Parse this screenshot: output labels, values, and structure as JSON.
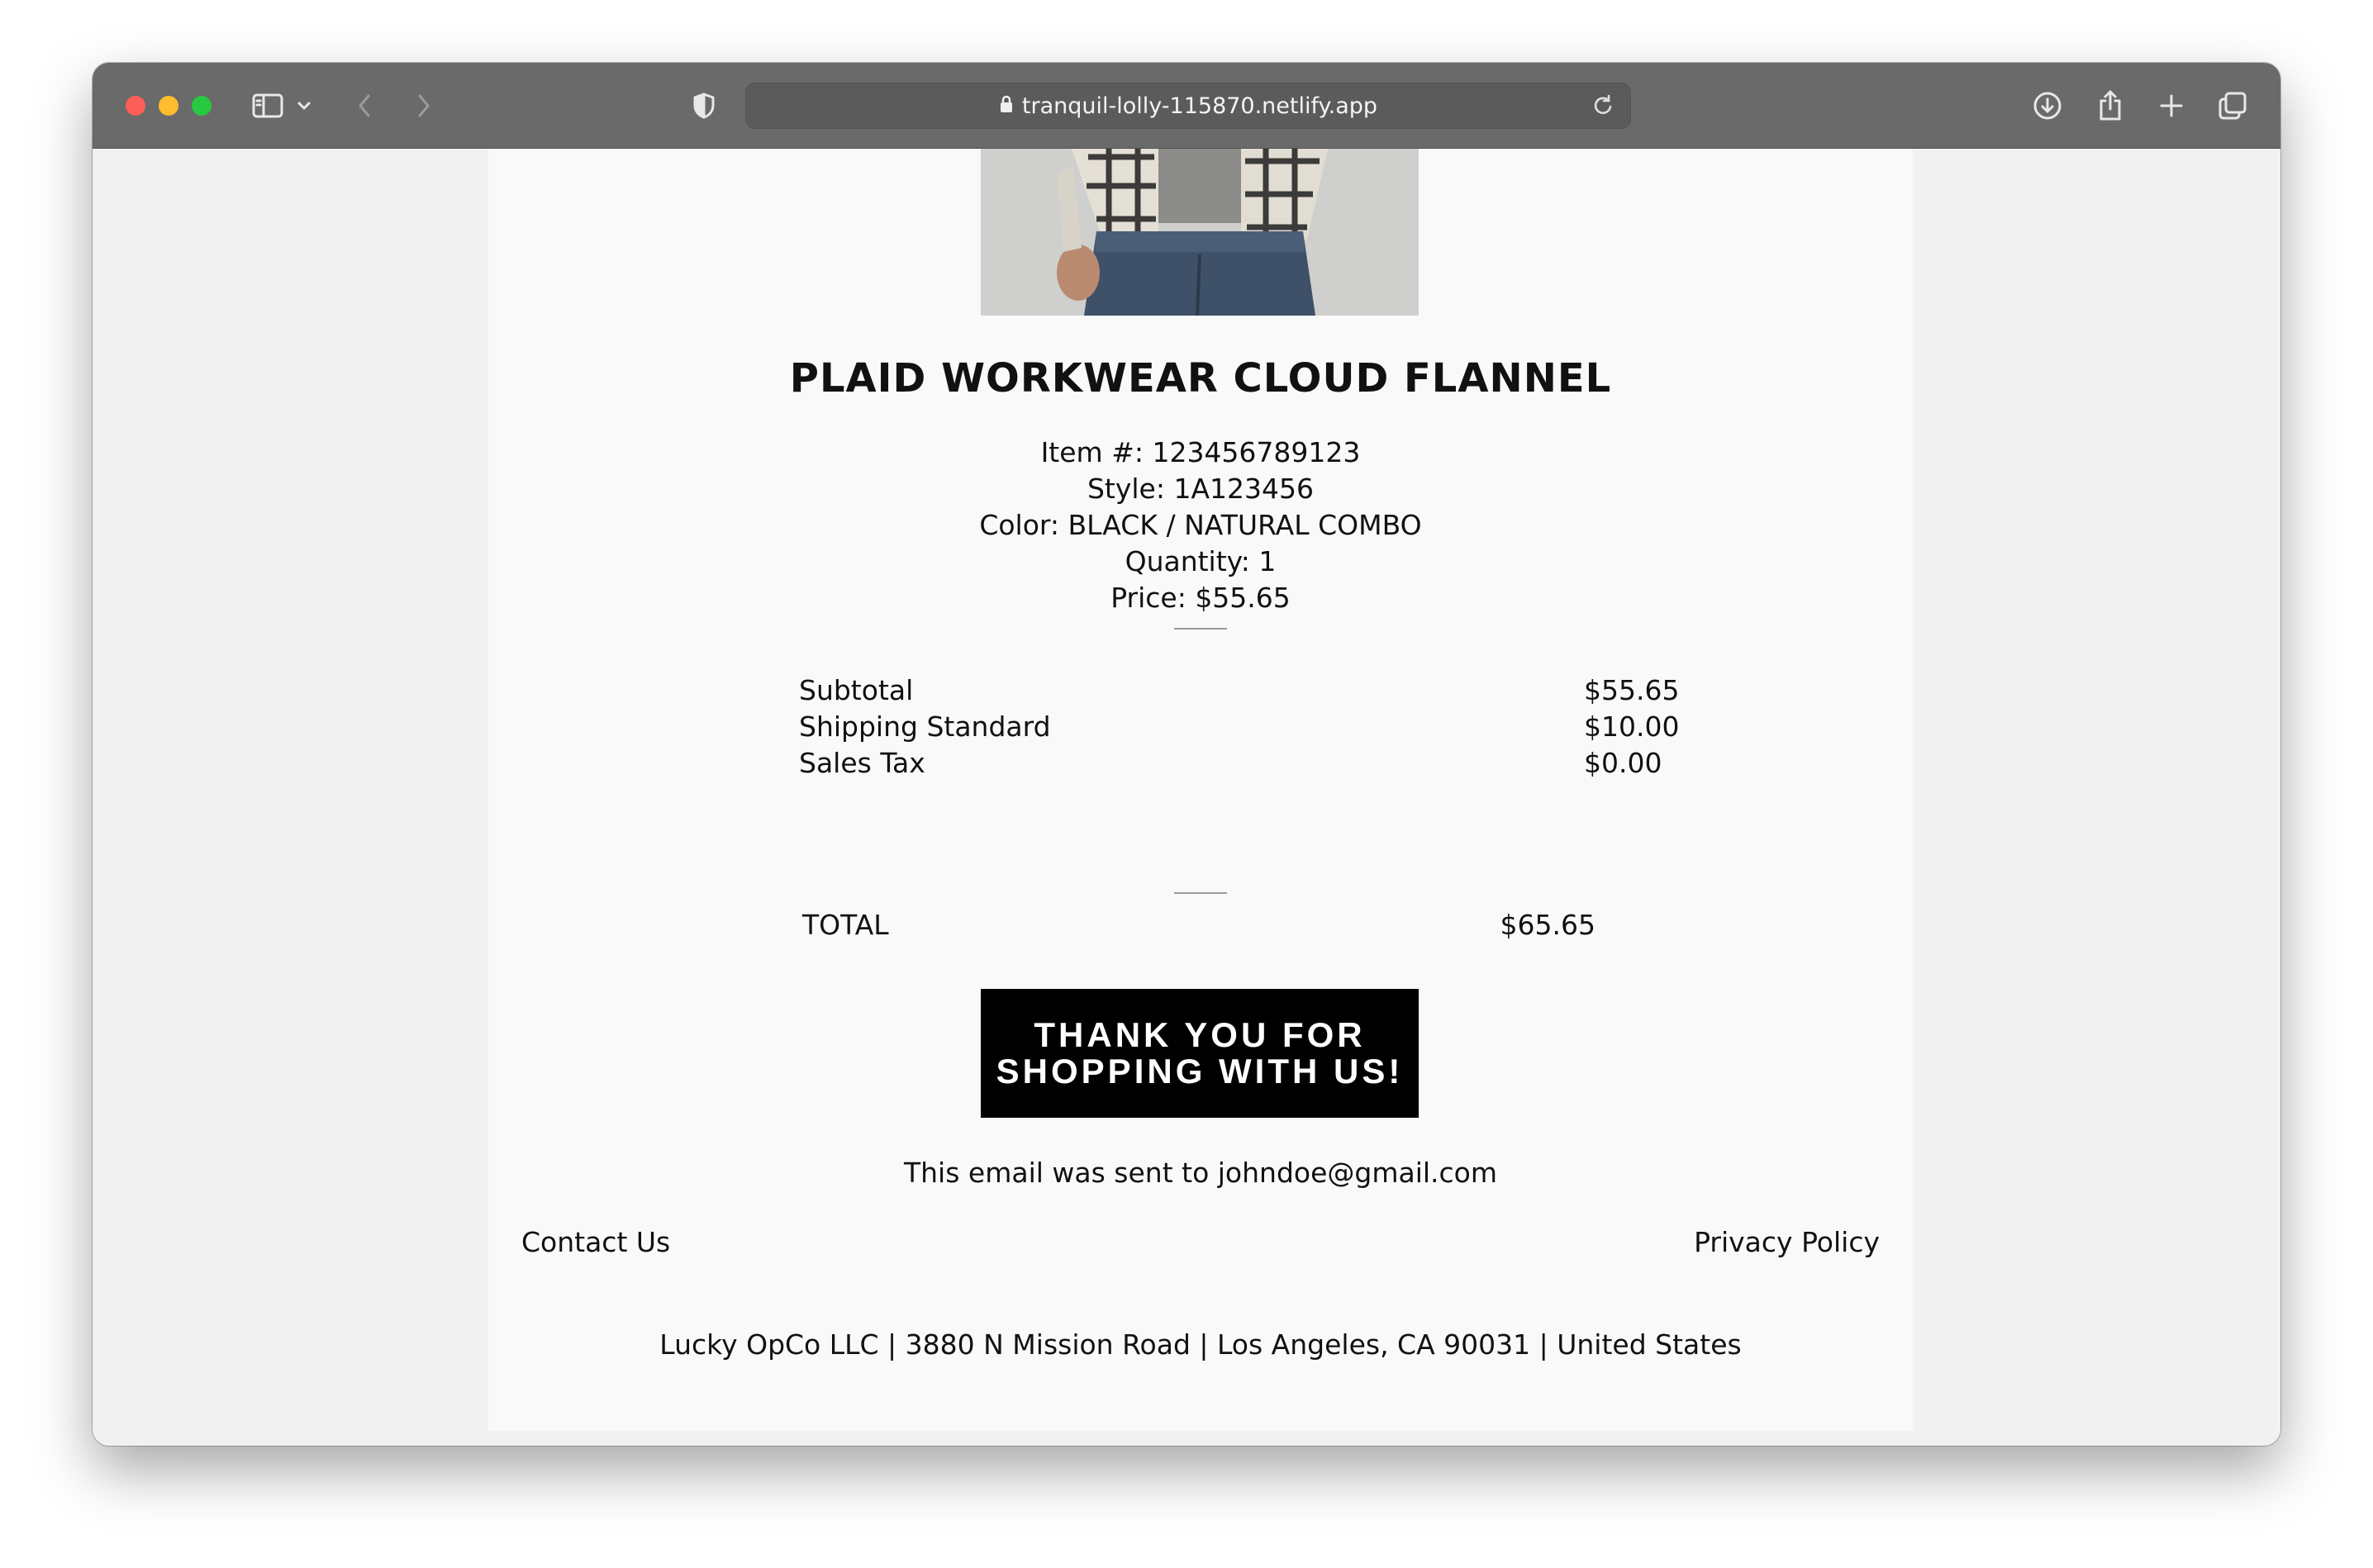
{
  "browser": {
    "url": "tranquil-lolly-115870.netlify.app"
  },
  "product": {
    "name": "PLAID WORKWEAR CLOUD FLANNEL",
    "item_number": "Item #: 123456789123",
    "style": "Style: 1A123456",
    "color": "Color: BLACK / NATURAL COMBO",
    "quantity": "Quantity: 1",
    "price": "Price: $55.65"
  },
  "summary": {
    "rows": [
      {
        "label": "Subtotal",
        "amount": "$55.65"
      },
      {
        "label": "Shipping Standard",
        "amount": "$10.00"
      },
      {
        "label": "Sales Tax",
        "amount": "$0.00"
      }
    ],
    "total_label": "TOTAL",
    "total_amount": "$65.65"
  },
  "thanks_banner": {
    "line1": "THANK YOU FOR",
    "line2": "SHOPPING WITH US!"
  },
  "sent_to": "This email was sent to johndoe@gmail.com",
  "footer": {
    "contact": "Contact Us",
    "privacy": "Privacy Policy",
    "address": "Lucky OpCo LLC | 3880 N Mission Road | Los Angeles, CA 90031 | United States"
  }
}
